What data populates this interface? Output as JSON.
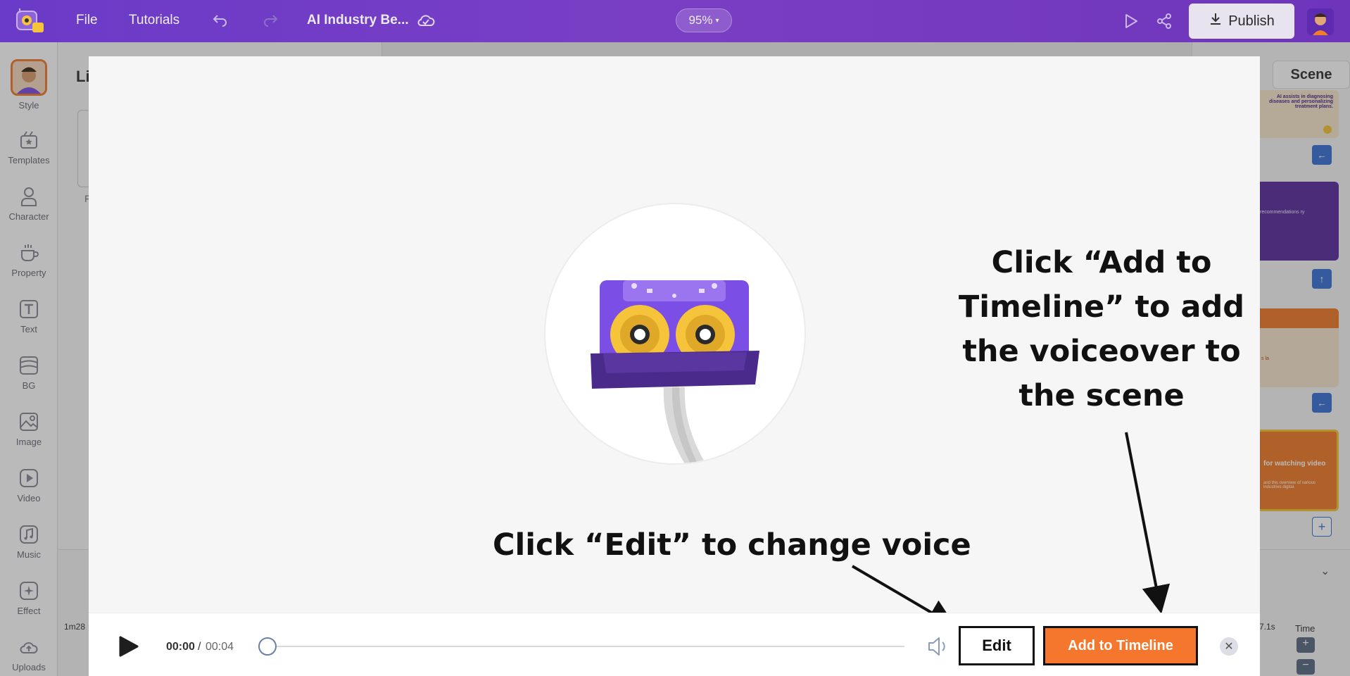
{
  "topbar": {
    "file_label": "File",
    "tutorials_label": "Tutorials",
    "project_title": "AI Industry Be...",
    "zoom": "95%",
    "publish_label": "Publish"
  },
  "sidebar": {
    "items": [
      {
        "label": "Style",
        "icon": "avatar-icon"
      },
      {
        "label": "Templates",
        "icon": "templates-icon"
      },
      {
        "label": "Character",
        "icon": "character-icon"
      },
      {
        "label": "Property",
        "icon": "property-icon"
      },
      {
        "label": "Text",
        "icon": "text-icon"
      },
      {
        "label": "BG",
        "icon": "bg-icon"
      },
      {
        "label": "Image",
        "icon": "image-icon"
      },
      {
        "label": "Video",
        "icon": "video-icon"
      },
      {
        "label": "Music",
        "icon": "music-icon"
      },
      {
        "label": "Effect",
        "icon": "effect-icon"
      },
      {
        "label": "Uploads",
        "icon": "uploads-icon"
      }
    ]
  },
  "background": {
    "panel_title_fragment": "Li",
    "panel_tab_fragment": "F",
    "add_scene_fragment": "Scene",
    "timeline_time_fragment": "1m28",
    "timeline_duration_fragment": "7.1s",
    "time_label": "Time",
    "scenes": [
      {
        "text": "AI assists in diagnosing diseases and personalizing treatment plans."
      },
      {
        "text": "recommendations ry"
      },
      {
        "text": "s la"
      },
      {
        "text": "for watching video",
        "subtext": "and this overview of various industries digital."
      }
    ]
  },
  "modal": {
    "annotation_add": "Click “Add to Timeline” to add the voiceover to the scene",
    "annotation_edit": "Click “Edit” to change voice",
    "player": {
      "current_time": "00:00",
      "separator": "/",
      "total_time": "00:04",
      "progress": 0
    },
    "edit_label": "Edit",
    "add_to_timeline_label": "Add to Timeline",
    "close_symbol": "✕"
  },
  "colors": {
    "topbar": "#6a3bc8",
    "accent_orange": "#f4772d",
    "cassette_purple": "#7b4ee6",
    "reel_yellow": "#f5c43a"
  }
}
